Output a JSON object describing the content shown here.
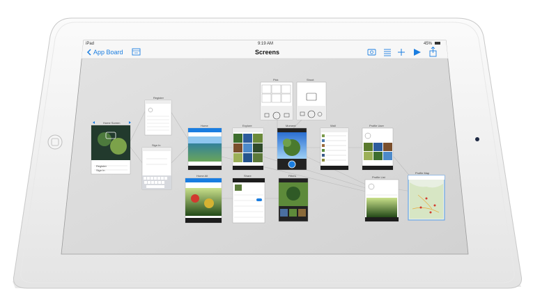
{
  "status_bar": {
    "device": "iPad",
    "time": "9:19 AM",
    "battery": "45%"
  },
  "nav_bar": {
    "back_label": "App Board",
    "title": "Screens",
    "icons": [
      "back-chevron-icon",
      "storyboard-icon",
      "camera-icon",
      "list-icon",
      "add-icon",
      "play-icon",
      "share-icon"
    ]
  },
  "screens": [
    {
      "id": "home",
      "label": "Home Screen",
      "items": [
        "Register",
        "Sign In"
      ]
    },
    {
      "id": "register",
      "label": "Register"
    },
    {
      "id": "signin",
      "label": "Sign In"
    },
    {
      "id": "home2",
      "label": "Home"
    },
    {
      "id": "explore",
      "label": "Explore"
    },
    {
      "id": "moment",
      "label": "Moment"
    },
    {
      "id": "wall",
      "label": "Wall"
    },
    {
      "id": "profile_user",
      "label": "Profile User"
    },
    {
      "id": "profile_map",
      "label": "Profile Map"
    },
    {
      "id": "profile_list",
      "label": "Profile List"
    },
    {
      "id": "home_alt",
      "label": "Home Alt"
    },
    {
      "id": "share",
      "label": "Share"
    },
    {
      "id": "filters",
      "label": "Filters"
    },
    {
      "id": "pick",
      "label": "Pick"
    },
    {
      "id": "shoot",
      "label": "Shoot"
    }
  ],
  "colors": {
    "accent": "#1a7de0",
    "canvas": "#d8d8d8",
    "bezel": "#f2f2f2",
    "map_border": "#6aa6e8"
  }
}
